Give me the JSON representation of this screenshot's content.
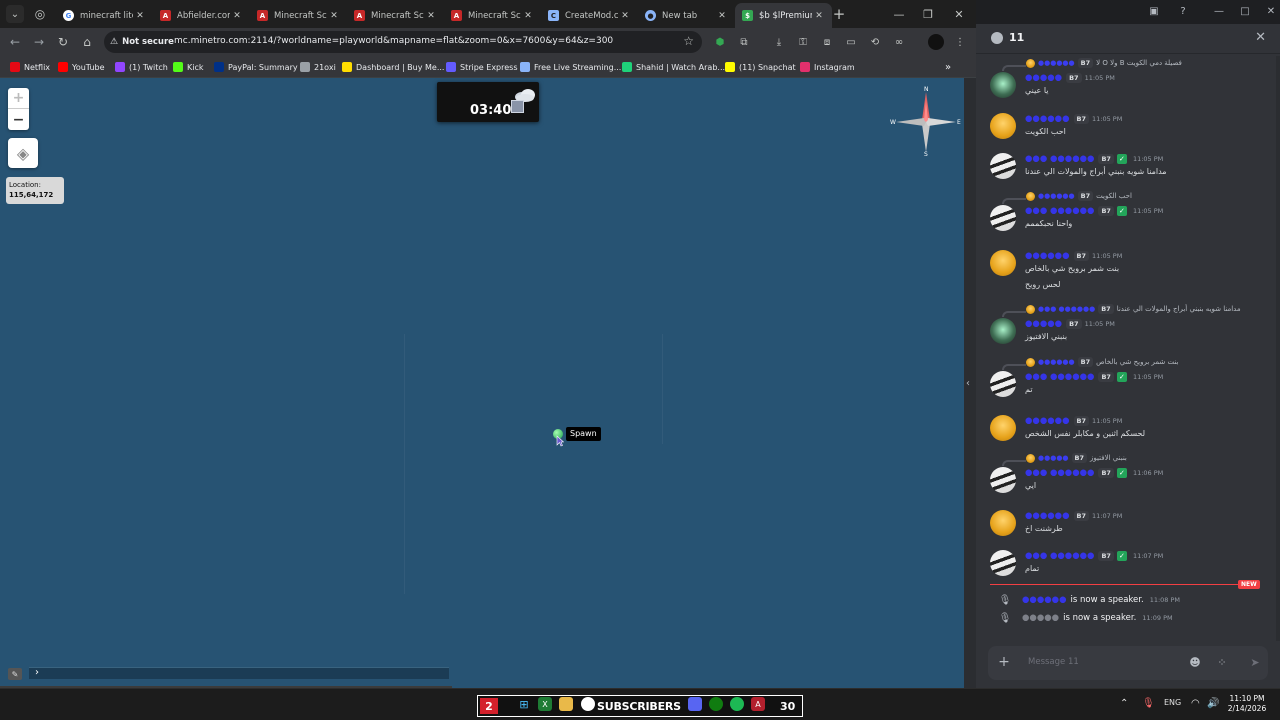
{
  "browser": {
    "tabs": [
      {
        "title": "minecraft lite",
        "favicon": "google-icon",
        "active": false
      },
      {
        "title": "Abfielder.com",
        "favicon": "aternos-icon",
        "active": false
      },
      {
        "title": "Minecraft Sch",
        "favicon": "aternos-icon",
        "active": false
      },
      {
        "title": "Minecraft Sch",
        "favicon": "aternos-icon",
        "active": false
      },
      {
        "title": "Minecraft Sch",
        "favicon": "aternos-icon",
        "active": false
      },
      {
        "title": "CreateMod.co",
        "favicon": "createmod-icon",
        "active": false
      },
      {
        "title": "New tab",
        "favicon": "chrome-icon",
        "active": false
      },
      {
        "title": "$b $lPremium",
        "favicon": "page-icon",
        "active": true
      }
    ],
    "address": {
      "security": "Not secure",
      "url": "mc.minetro.com:2114/?worldname=playworld&mapname=flat&zoom=0&x=7600&y=64&z=300"
    },
    "bookmarks": [
      {
        "label": "Netflix",
        "icon": "netflix-icon",
        "color": "#e50914"
      },
      {
        "label": "YouTube",
        "icon": "youtube-icon",
        "color": "#ff0000"
      },
      {
        "label": "(1) Twitch",
        "icon": "twitch-icon",
        "color": "#9146ff"
      },
      {
        "label": "Kick",
        "icon": "kick-icon",
        "color": "#53fc18"
      },
      {
        "label": "PayPal: Summary",
        "icon": "paypal-icon",
        "color": "#003087"
      },
      {
        "label": "21oxi",
        "icon": "globe-icon",
        "color": "#9aa0a6"
      },
      {
        "label": "Dashboard | Buy Me...",
        "icon": "coffee-icon",
        "color": "#ffdd00"
      },
      {
        "label": "Stripe Express",
        "icon": "stripe-icon",
        "color": "#635bff"
      },
      {
        "label": "Free Live Streaming...",
        "icon": "stream-icon",
        "color": "#8ab4f8"
      },
      {
        "label": "Shahid | Watch Arab...",
        "icon": "shahid-icon",
        "color": "#1fd27a"
      },
      {
        "label": "(11) Snapchat",
        "icon": "snapchat-icon",
        "color": "#fffc00"
      },
      {
        "label": "Instagram",
        "icon": "instagram-icon",
        "color": "#e1306c"
      }
    ]
  },
  "map": {
    "zoom_in": "+",
    "zoom_out": "−",
    "location_label": "Location:",
    "location_value": "115,64,172",
    "clock_time": "03:40",
    "compass": {
      "n": "N",
      "e": "E",
      "s": "S",
      "w": "W"
    },
    "marker_label": "Spawn",
    "water_color": "#275373"
  },
  "discord": {
    "channel_count": "11",
    "messages": [
      {
        "reply": {
          "name": "●●●●●●",
          "tag": "B7",
          "text": "لا O ولا B فصيلة دمي الكويت"
        },
        "avatar": "green",
        "name": "●●●●●",
        "tag": "B7",
        "verified": false,
        "time": "11:05 PM",
        "lines": [
          "يا عيني"
        ]
      },
      {
        "avatar": "gold",
        "name": "●●●●●●",
        "tag": "B7",
        "verified": false,
        "time": "11:05 PM",
        "lines": [
          "احب الكويت"
        ]
      },
      {
        "avatar": "piano",
        "name": "●●● ●●●●●●",
        "tag": "B7",
        "verified": true,
        "time": "11:05 PM",
        "lines": [
          "مدامنا شويه بنبني أبراج والمولات الي عندنا"
        ]
      },
      {
        "reply": {
          "name": "●●●●●●",
          "tag": "B7",
          "text": "احب الكويت"
        },
        "avatar": "piano",
        "name": "●●● ●●●●●●",
        "tag": "B7",
        "verified": true,
        "time": "11:05 PM",
        "lines": [
          "واحنا نحبكممم"
        ]
      },
      {
        "avatar": "gold",
        "name": "●●●●●●",
        "tag": "B7",
        "verified": false,
        "time": "11:05 PM",
        "lines": [
          "بنت شمر برويح شي بالخاص",
          "لحس رويح"
        ]
      },
      {
        "reply": {
          "name": "●●● ●●●●●●",
          "tag": "B7",
          "text": "مدامنا شويه بنبني أبراج والمولات الي عندنا"
        },
        "avatar": "green",
        "name": "●●●●●",
        "tag": "B7",
        "verified": false,
        "time": "11:05 PM",
        "lines": [
          "بنبني الافتيوز"
        ]
      },
      {
        "reply": {
          "name": "●●●●●●",
          "tag": "B7",
          "text": "بنت شمر برويح شي بالخاص"
        },
        "avatar": "piano",
        "name": "●●● ●●●●●●",
        "tag": "B7",
        "verified": true,
        "time": "11:05 PM",
        "lines": [
          "تم"
        ]
      },
      {
        "avatar": "gold",
        "name": "●●●●●●",
        "tag": "B7",
        "verified": false,
        "time": "11:05 PM",
        "lines": [
          "لحسكم اثنين و مكابلر نفس الشخص"
        ]
      },
      {
        "reply": {
          "name": "●●●●●",
          "tag": "B7",
          "text": "بنبني الافتيوز"
        },
        "avatar": "piano",
        "name": "●●● ●●●●●●",
        "tag": "B7",
        "verified": true,
        "time": "11:06 PM",
        "lines": [
          "ايي"
        ]
      },
      {
        "avatar": "gold",
        "name": "●●●●●●",
        "tag": "B7",
        "verified": false,
        "time": "11:07 PM",
        "lines": [
          "طرشنت اخ"
        ]
      },
      {
        "avatar": "piano",
        "name": "●●● ●●●●●●",
        "tag": "B7",
        "verified": true,
        "time": "11:07 PM",
        "lines": [
          "تمام"
        ]
      }
    ],
    "new_badge": "NEW",
    "system": [
      {
        "name": "●●●●●●",
        "text": "is now a speaker.",
        "time": "11:08 PM",
        "grey": false
      },
      {
        "name": "●●●●●",
        "text": "is now a speaker.",
        "time": "11:09 PM",
        "grey": true
      }
    ],
    "composer_placeholder": "Message 11"
  },
  "taskbar": {
    "overlay_count": "2",
    "overlay_label": "SUBSCRIBERS",
    "overlay_goal": "30",
    "lang": "ENG",
    "time": "11:10 PM",
    "date": "2/14/2026"
  }
}
